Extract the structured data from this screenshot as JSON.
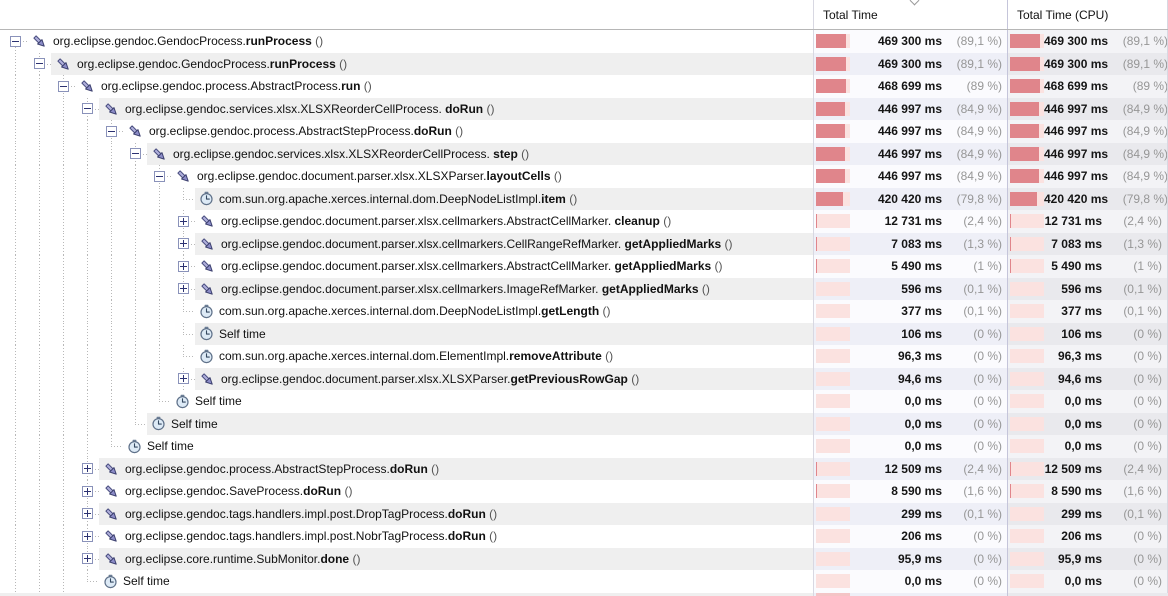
{
  "header": {
    "method_column_label": "",
    "total_time_label": "Total Time",
    "total_time_cpu_label": "Total Time (CPU)"
  },
  "labels": {
    "parens_suffix": "()"
  },
  "colors": {
    "bar_fill": "#e0858b",
    "bar_track": "#fbe2e0",
    "stripe_tree": "#efefef",
    "stripe_total": "#eeeff7",
    "stripe_cpu": "#e9e9ed",
    "column_separator": "#c5c5da"
  },
  "rows": [
    {
      "depth": 0,
      "node": "expanded",
      "icon": "method",
      "package": "org.eclipse.gendoc.GendocProcess.",
      "method": "runProcess",
      "total_time": "469 300 ms",
      "total_pct": "(89,1 %)",
      "cpu_time": "469 300 ms",
      "cpu_pct": "(89,1 %)",
      "bar_fill_pct": 89.1
    },
    {
      "depth": 1,
      "node": "expanded",
      "icon": "method",
      "package": "org.eclipse.gendoc.GendocProcess.",
      "method": "runProcess",
      "total_time": "469 300 ms",
      "total_pct": "(89,1 %)",
      "cpu_time": "469 300 ms",
      "cpu_pct": "(89,1 %)",
      "bar_fill_pct": 89.1
    },
    {
      "depth": 2,
      "node": "expanded",
      "icon": "method",
      "package": "org.eclipse.gendoc.process.AbstractProcess.",
      "method": "run",
      "total_time": "468 699 ms",
      "total_pct": "(89 %)",
      "cpu_time": "468 699 ms",
      "cpu_pct": "(89 %)",
      "bar_fill_pct": 89
    },
    {
      "depth": 3,
      "node": "expanded",
      "icon": "method",
      "package": "org.eclipse.gendoc.services.xlsx.XLSXReorderCellProcess. ",
      "method": "doRun",
      "total_time": "446 997 ms",
      "total_pct": "(84,9 %)",
      "cpu_time": "446 997 ms",
      "cpu_pct": "(84,9 %)",
      "bar_fill_pct": 84.9
    },
    {
      "depth": 4,
      "node": "expanded",
      "icon": "method",
      "package": "org.eclipse.gendoc.process.AbstractStepProcess.",
      "method": "doRun",
      "total_time": "446 997 ms",
      "total_pct": "(84,9 %)",
      "cpu_time": "446 997 ms",
      "cpu_pct": "(84,9 %)",
      "bar_fill_pct": 84.9
    },
    {
      "depth": 5,
      "node": "expanded",
      "icon": "method",
      "package": "org.eclipse.gendoc.services.xlsx.XLSXReorderCellProcess. ",
      "method": "step",
      "total_time": "446 997 ms",
      "total_pct": "(84,9 %)",
      "cpu_time": "446 997 ms",
      "cpu_pct": "(84,9 %)",
      "bar_fill_pct": 84.9
    },
    {
      "depth": 6,
      "node": "expanded",
      "icon": "method",
      "package": "org.eclipse.gendoc.document.parser.xlsx.XLSXParser.",
      "method": "layoutCells",
      "total_time": "446 997 ms",
      "total_pct": "(84,9 %)",
      "cpu_time": "446 997 ms",
      "cpu_pct": "(84,9 %)",
      "bar_fill_pct": 84.9
    },
    {
      "depth": 7,
      "node": "leaf",
      "icon": "clock",
      "package": "com.sun.org.apache.xerces.internal.dom.DeepNodeListImpl.",
      "method": "item",
      "total_time": "420 420 ms",
      "total_pct": "(79,8 %)",
      "cpu_time": "420 420 ms",
      "cpu_pct": "(79,8 %)",
      "bar_fill_pct": 79.8
    },
    {
      "depth": 7,
      "node": "collapsed",
      "icon": "method",
      "package": "org.eclipse.gendoc.document.parser.xlsx.cellmarkers.AbstractCellMarker. ",
      "method": "cleanup",
      "total_time": "12 731 ms",
      "total_pct": "(2,4 %)",
      "cpu_time": "12 731 ms",
      "cpu_pct": "(2,4 %)",
      "bar_fill_pct": 2.4
    },
    {
      "depth": 7,
      "node": "collapsed",
      "icon": "method",
      "package": "org.eclipse.gendoc.document.parser.xlsx.cellmarkers.CellRangeRefMarker. ",
      "method": "getAppliedMarks",
      "total_time": "7 083 ms",
      "total_pct": "(1,3 %)",
      "cpu_time": "7 083 ms",
      "cpu_pct": "(1,3 %)",
      "bar_fill_pct": 1.3
    },
    {
      "depth": 7,
      "node": "collapsed",
      "icon": "method",
      "package": "org.eclipse.gendoc.document.parser.xlsx.cellmarkers.AbstractCellMarker. ",
      "method": "getAppliedMarks",
      "total_time": "5 490 ms",
      "total_pct": "(1 %)",
      "cpu_time": "5 490 ms",
      "cpu_pct": "(1 %)",
      "bar_fill_pct": 1
    },
    {
      "depth": 7,
      "node": "collapsed",
      "icon": "method",
      "package": "org.eclipse.gendoc.document.parser.xlsx.cellmarkers.ImageRefMarker. ",
      "method": "getAppliedMarks",
      "total_time": "596 ms",
      "total_pct": "(0,1 %)",
      "cpu_time": "596 ms",
      "cpu_pct": "(0,1 %)",
      "bar_fill_pct": 0.1
    },
    {
      "depth": 7,
      "node": "leaf",
      "icon": "clock",
      "package": "com.sun.org.apache.xerces.internal.dom.DeepNodeListImpl.",
      "method": "getLength",
      "total_time": "377 ms",
      "total_pct": "(0,1 %)",
      "cpu_time": "377 ms",
      "cpu_pct": "(0,1 %)",
      "bar_fill_pct": 0.1
    },
    {
      "depth": 7,
      "node": "leaf",
      "icon": "clock",
      "label": "Self time",
      "total_time": "106 ms",
      "total_pct": "(0 %)",
      "cpu_time": "106 ms",
      "cpu_pct": "(0 %)",
      "bar_fill_pct": 0
    },
    {
      "depth": 7,
      "node": "leaf",
      "icon": "clock",
      "package": "com.sun.org.apache.xerces.internal.dom.ElementImpl.",
      "method": "removeAttribute",
      "total_time": "96,3 ms",
      "total_pct": "(0 %)",
      "cpu_time": "96,3 ms",
      "cpu_pct": "(0 %)",
      "bar_fill_pct": 0
    },
    {
      "depth": 7,
      "node": "collapsed",
      "icon": "method",
      "package": "org.eclipse.gendoc.document.parser.xlsx.XLSXParser.",
      "method": "getPreviousRowGap",
      "total_time": "94,6 ms",
      "total_pct": "(0 %)",
      "cpu_time": "94,6 ms",
      "cpu_pct": "(0 %)",
      "bar_fill_pct": 0
    },
    {
      "depth": 6,
      "node": "leaf",
      "icon": "clock",
      "label": "Self time",
      "total_time": "0,0 ms",
      "total_pct": "(0 %)",
      "cpu_time": "0,0 ms",
      "cpu_pct": "(0 %)",
      "bar_fill_pct": 0
    },
    {
      "depth": 5,
      "node": "leaf",
      "icon": "clock",
      "label": "Self time",
      "total_time": "0,0 ms",
      "total_pct": "(0 %)",
      "cpu_time": "0,0 ms",
      "cpu_pct": "(0 %)",
      "bar_fill_pct": 0
    },
    {
      "depth": 4,
      "node": "leaf",
      "icon": "clock",
      "label": "Self time",
      "total_time": "0,0 ms",
      "total_pct": "(0 %)",
      "cpu_time": "0,0 ms",
      "cpu_pct": "(0 %)",
      "bar_fill_pct": 0
    },
    {
      "depth": 3,
      "node": "collapsed",
      "icon": "method",
      "package": "org.eclipse.gendoc.process.AbstractStepProcess.",
      "method": "doRun",
      "total_time": "12 509 ms",
      "total_pct": "(2,4 %)",
      "cpu_time": "12 509 ms",
      "cpu_pct": "(2,4 %)",
      "bar_fill_pct": 2.4
    },
    {
      "depth": 3,
      "node": "collapsed",
      "icon": "method",
      "package": "org.eclipse.gendoc.SaveProcess.",
      "method": "doRun",
      "total_time": "8 590 ms",
      "total_pct": "(1,6 %)",
      "cpu_time": "8 590 ms",
      "cpu_pct": "(1,6 %)",
      "bar_fill_pct": 1.6
    },
    {
      "depth": 3,
      "node": "collapsed",
      "icon": "method",
      "package": "org.eclipse.gendoc.tags.handlers.impl.post.DropTagProcess.",
      "method": "doRun",
      "total_time": "299 ms",
      "total_pct": "(0,1 %)",
      "cpu_time": "299 ms",
      "cpu_pct": "(0,1 %)",
      "bar_fill_pct": 0.1
    },
    {
      "depth": 3,
      "node": "collapsed",
      "icon": "method",
      "package": "org.eclipse.gendoc.tags.handlers.impl.post.NobrTagProcess.",
      "method": "doRun",
      "total_time": "206 ms",
      "total_pct": "(0 %)",
      "cpu_time": "206 ms",
      "cpu_pct": "(0 %)",
      "bar_fill_pct": 0
    },
    {
      "depth": 3,
      "node": "collapsed",
      "icon": "method",
      "package": "org.eclipse.core.runtime.SubMonitor.",
      "method": "done",
      "total_time": "95,9 ms",
      "total_pct": "(0 %)",
      "cpu_time": "95,9 ms",
      "cpu_pct": "(0 %)",
      "bar_fill_pct": 0
    },
    {
      "depth": 3,
      "node": "leaf",
      "icon": "clock",
      "label": "Self time",
      "total_time": "0,0 ms",
      "total_pct": "(0 %)",
      "cpu_time": "0,0 ms",
      "cpu_pct": "(0 %)",
      "bar_fill_pct": 0
    }
  ],
  "partial_bottom_row": true
}
